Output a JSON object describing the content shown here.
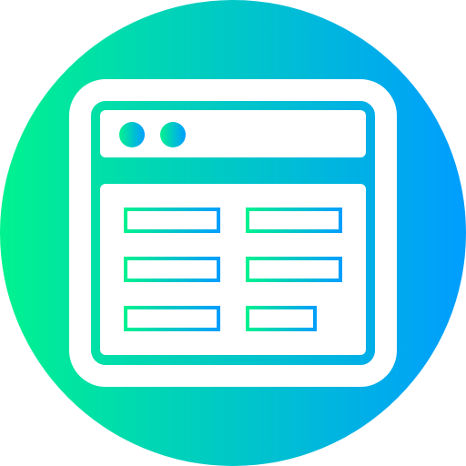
{
  "icon": {
    "name": "browser-window-table-icon",
    "gradient": {
      "start": "#00F28F",
      "end": "#009DFF"
    },
    "foreground": "#FFFFFF"
  }
}
